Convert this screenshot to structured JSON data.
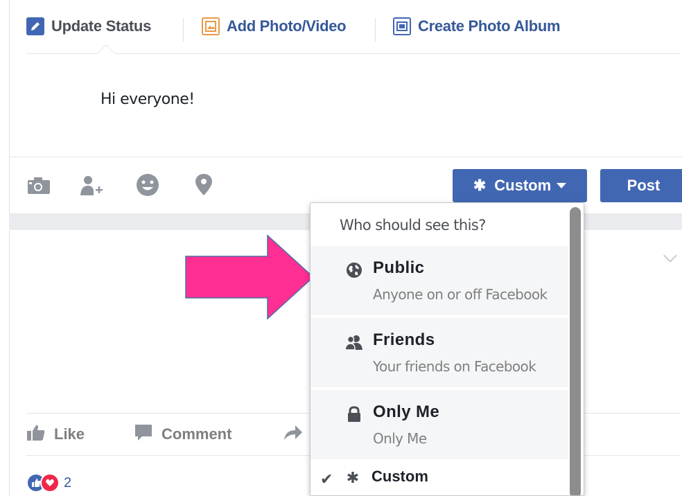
{
  "composer": {
    "tabs": [
      {
        "label": "Update Status"
      },
      {
        "label": "Add Photo/Video"
      },
      {
        "label": "Create Photo Album"
      }
    ],
    "status_text": "Hi everyone!",
    "audience_button": "Custom",
    "post_button": "Post",
    "tool_icons": [
      "camera-icon",
      "tag-friends-icon",
      "feeling-icon",
      "location-icon"
    ]
  },
  "audience_menu": {
    "header": "Who should see this?",
    "options": [
      {
        "title": "Public",
        "subtitle": "Anyone on or off Facebook",
        "icon": "globe-icon"
      },
      {
        "title": "Friends",
        "subtitle": "Your friends on Facebook",
        "icon": "friends-icon"
      },
      {
        "title": "Only Me",
        "subtitle": "Only Me",
        "icon": "lock-icon"
      },
      {
        "title": "Custom",
        "icon": "gear-icon",
        "selected": true
      }
    ]
  },
  "post": {
    "actions": [
      {
        "label": "Like"
      },
      {
        "label": "Comment"
      }
    ],
    "reaction_count": "2"
  },
  "colors": {
    "facebook_blue": "#4267b2",
    "link_blue": "#365899",
    "arrow_pink": "#ff2e93"
  }
}
